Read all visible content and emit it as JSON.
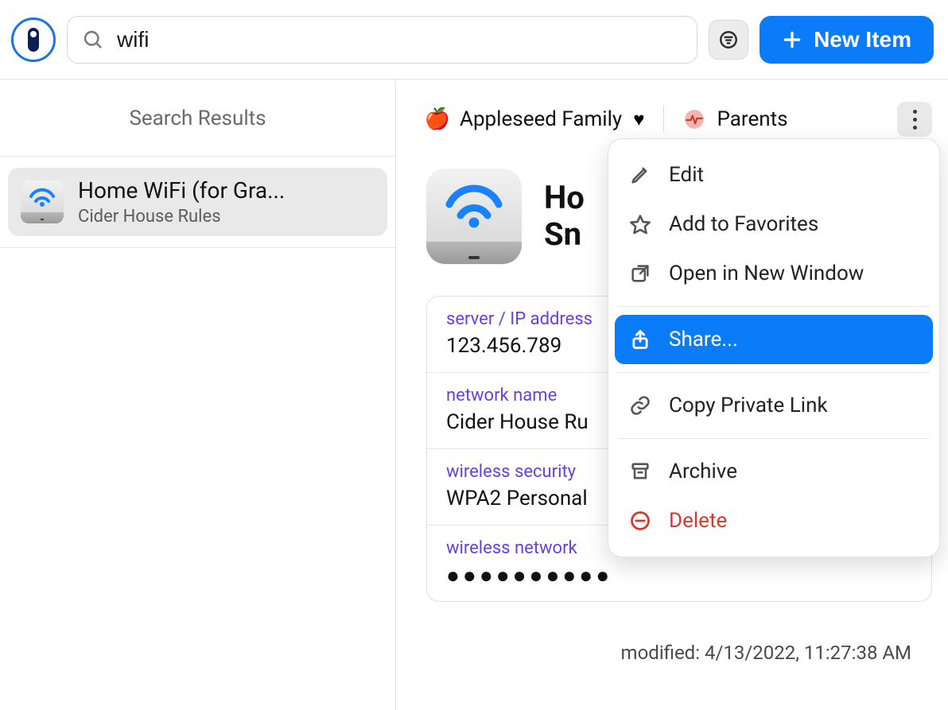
{
  "toolbar": {
    "search_value": "wifi",
    "new_item_label": "New Item"
  },
  "sidebar": {
    "title": "Search Results",
    "items": [
      {
        "title": "Home WiFi (for Gra...",
        "subtitle": "Cider House Rules"
      }
    ]
  },
  "detail": {
    "vaults": [
      {
        "name": "Appleseed Family",
        "heart": true
      },
      {
        "name": "Parents",
        "heart": false
      }
    ],
    "item_title_line1": "Ho",
    "item_title_line2": "Sn",
    "fields": [
      {
        "label": "server / IP address",
        "value": "123.456.789",
        "type": "text"
      },
      {
        "label": "network name",
        "value": "Cider House Ru",
        "type": "text"
      },
      {
        "label": "wireless security",
        "value": "WPA2 Personal",
        "type": "text"
      },
      {
        "label": "wireless network",
        "value": "●●●●●●●●●●",
        "type": "password"
      }
    ],
    "modified_label": "modified:",
    "modified_value": "4/13/2022, 11:27:38 AM"
  },
  "menu": {
    "items": [
      {
        "label": "Edit"
      },
      {
        "label": "Add to Favorites"
      },
      {
        "label": "Open in New Window"
      },
      {
        "label": "Share...",
        "highlighted": true
      },
      {
        "label": "Copy Private Link"
      },
      {
        "label": "Archive"
      },
      {
        "label": "Delete",
        "danger": true
      }
    ]
  }
}
